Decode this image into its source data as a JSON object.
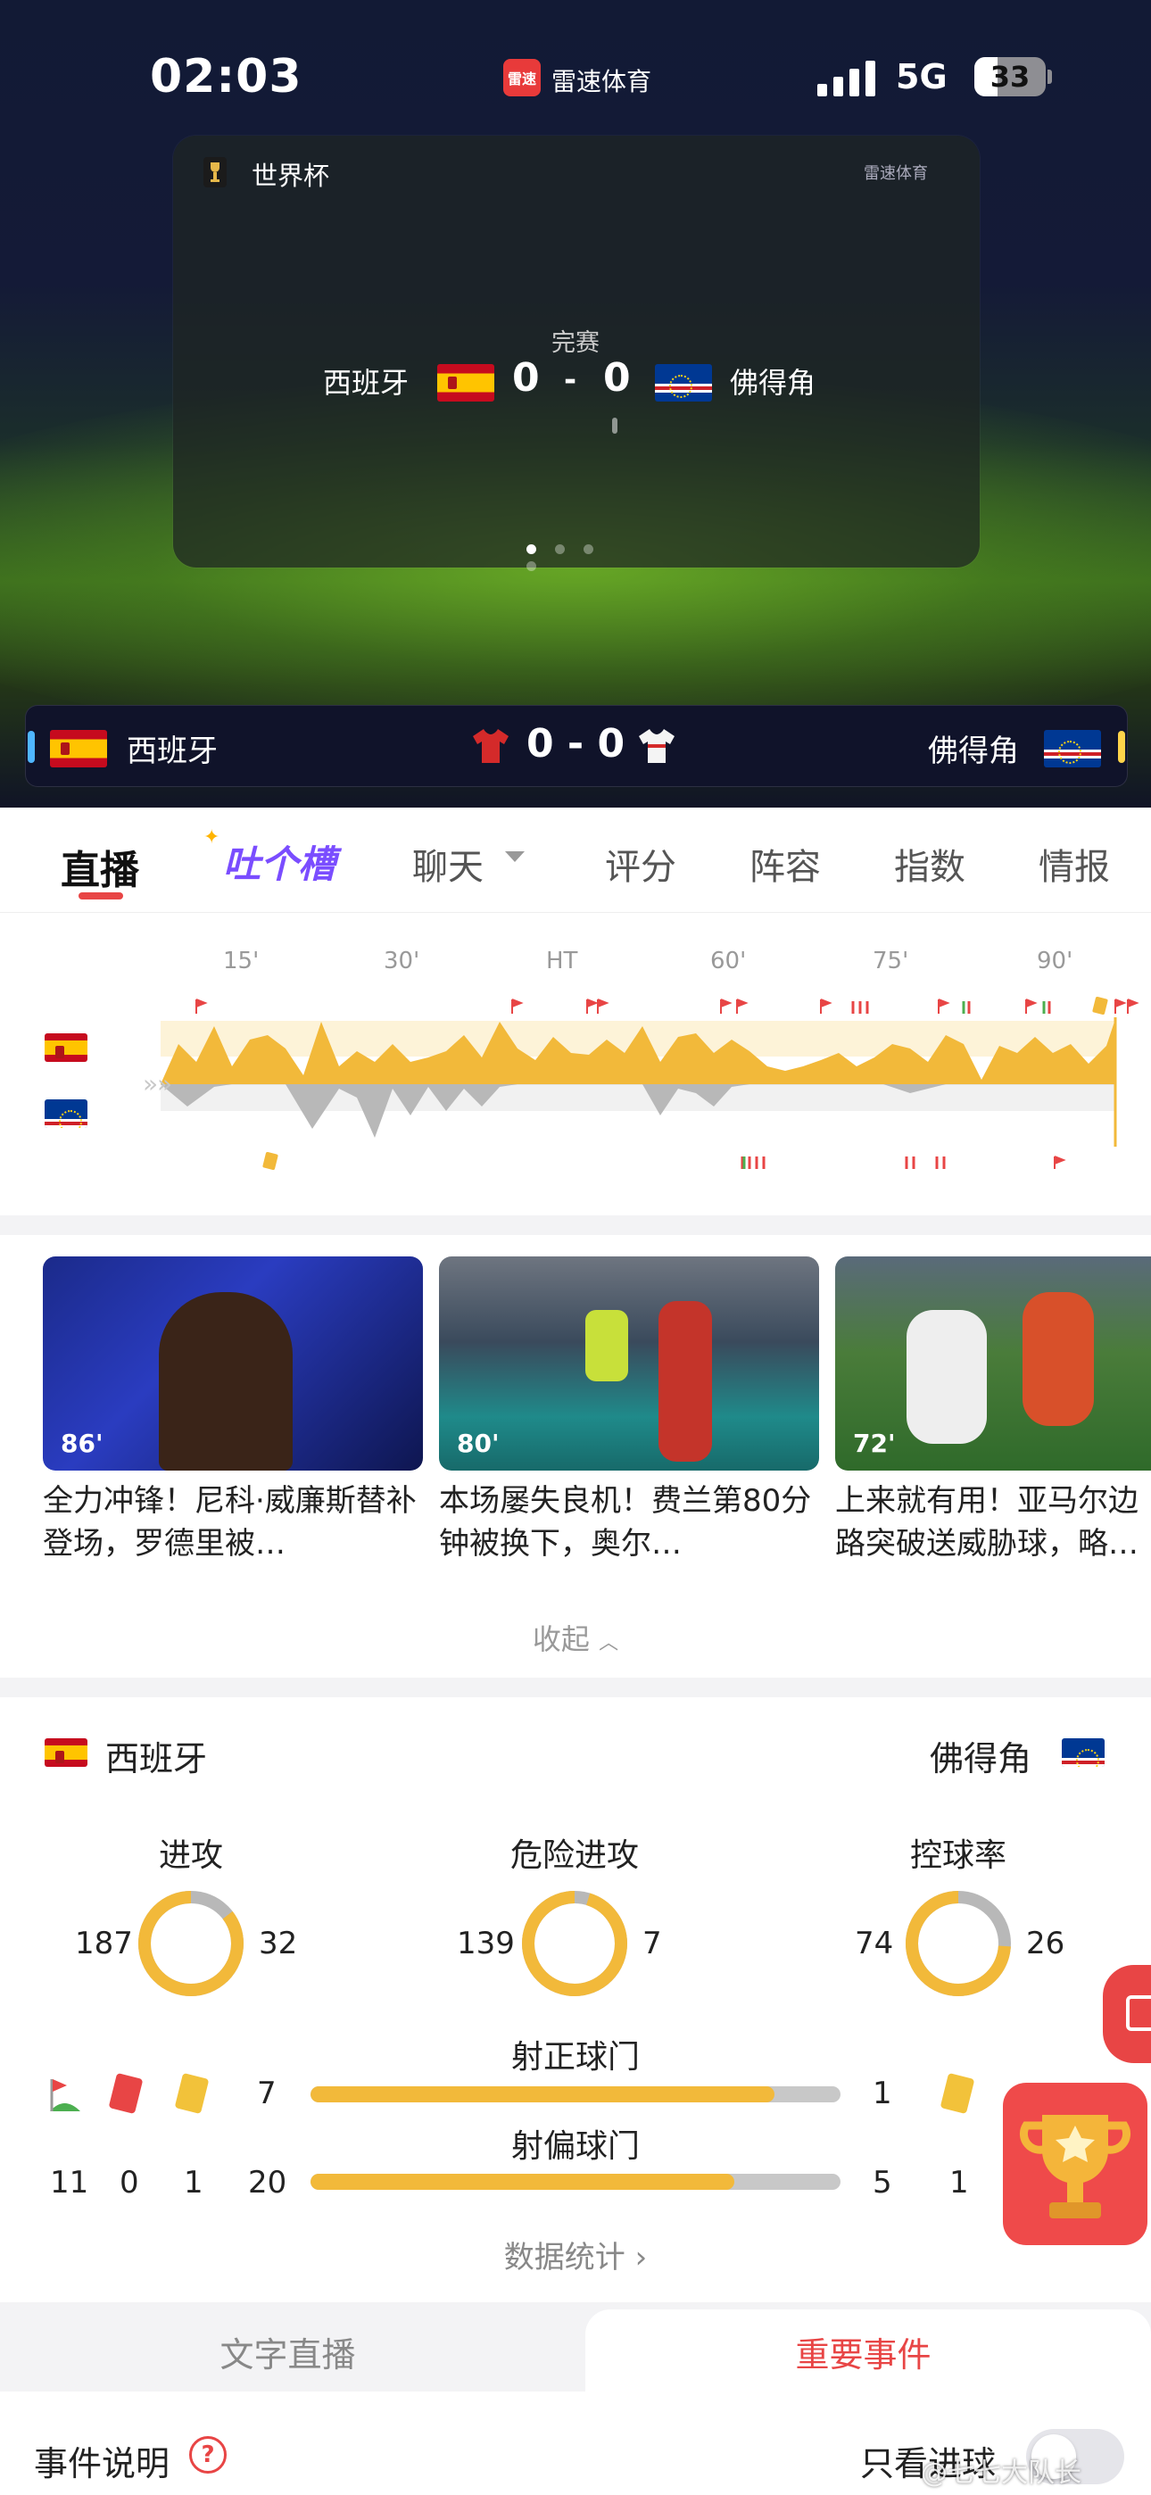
{
  "status_bar": {
    "time": "02:03",
    "network": "5G",
    "battery": "33",
    "battery_level": 0.33
  },
  "app": {
    "name": "雷速体育",
    "badge": "雷速"
  },
  "match_card": {
    "league": "世界杯",
    "watermark": "雷速体育",
    "status": "完赛",
    "home_team": "西班牙",
    "away_team": "佛得角",
    "home_score": "0",
    "separator": "-",
    "away_score": "0",
    "page_dots": 4,
    "active_dot": 0
  },
  "score_bar": {
    "home_team": "西班牙",
    "away_team": "佛得角",
    "score": "0 - 0"
  },
  "tabs": [
    {
      "label": "直播",
      "active": true
    },
    {
      "label": "吐个槽",
      "active": false
    },
    {
      "label": "聊天",
      "active": false
    },
    {
      "label": "评分",
      "active": false
    },
    {
      "label": "阵容",
      "active": false
    },
    {
      "label": "指数",
      "active": false
    },
    {
      "label": "情报",
      "active": false
    }
  ],
  "momentum": {
    "minute_labels": [
      "15'",
      "30'",
      "HT",
      "60'",
      "75'",
      "90'"
    ]
  },
  "videos": [
    {
      "minute": "86'",
      "caption": "全力冲锋！尼科·威廉斯替补登场，罗德里被…"
    },
    {
      "minute": "80'",
      "caption": "本场屡失良机！费兰第80分钟被换下，奥尔…"
    },
    {
      "minute": "72'",
      "caption": "上来就有用！亚马尔边路突破送威胁球，略…"
    }
  ],
  "collapse_label": "收起",
  "stats": {
    "home_team": "西班牙",
    "away_team": "佛得角",
    "donuts": [
      {
        "title": "进攻",
        "home": "187",
        "away": "32",
        "home_share": 0.854
      },
      {
        "title": "危险进攻",
        "home": "139",
        "away": "7",
        "home_share": 0.952
      },
      {
        "title": "控球率",
        "home": "74",
        "away": "26",
        "home_share": 0.74
      }
    ],
    "bars": [
      {
        "title": "射正球门",
        "home": "7",
        "away": "1",
        "home_share": 0.875
      },
      {
        "title": "射偏球门",
        "home": "20",
        "away": "5",
        "home_share": 0.8
      }
    ],
    "home_counts": {
      "corners": "11",
      "red_cards": "0",
      "yellow_cards": "1"
    },
    "away_counts": {
      "yellow_cards": "1"
    },
    "more_label": "数据统计"
  },
  "bottom_tabs": [
    {
      "label": "文字直播",
      "active": false
    },
    {
      "label": "重要事件",
      "active": true
    }
  ],
  "events": {
    "explain_label": "事件说明",
    "help": "?",
    "goals_only_label": "只看进球"
  },
  "watermark": "@七七大队长",
  "colors": {
    "accent": "#e84545",
    "momentum_home": "#f2b93a",
    "momentum_away": "#b8b8b8",
    "tucao": "#7a4dff"
  }
}
